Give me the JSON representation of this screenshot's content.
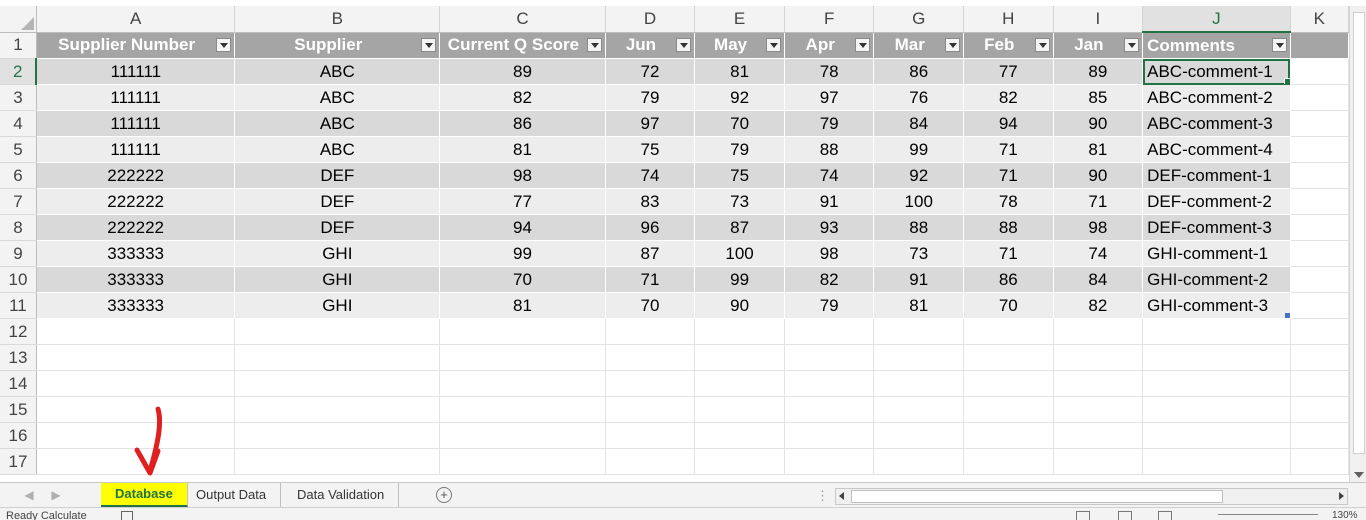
{
  "columns": [
    "A",
    "B",
    "C",
    "D",
    "E",
    "F",
    "G",
    "H",
    "I",
    "J",
    "K"
  ],
  "row_numbers": [
    "1",
    "2",
    "3",
    "4",
    "5",
    "6",
    "7",
    "8",
    "9",
    "10",
    "11",
    "12",
    "13",
    "14",
    "15",
    "16",
    "17"
  ],
  "table_headers": [
    "Supplier Number",
    "Supplier",
    "Current Q Score",
    "Jun",
    "May",
    "Apr",
    "Mar",
    "Feb",
    "Jan",
    "Comments"
  ],
  "rows": [
    [
      "111111",
      "ABC",
      "89",
      "72",
      "81",
      "78",
      "86",
      "77",
      "89",
      "ABC-comment-1"
    ],
    [
      "111111",
      "ABC",
      "82",
      "79",
      "92",
      "97",
      "76",
      "82",
      "85",
      "ABC-comment-2"
    ],
    [
      "111111",
      "ABC",
      "86",
      "97",
      "70",
      "79",
      "84",
      "94",
      "90",
      "ABC-comment-3"
    ],
    [
      "111111",
      "ABC",
      "81",
      "75",
      "79",
      "88",
      "99",
      "71",
      "81",
      "ABC-comment-4"
    ],
    [
      "222222",
      "DEF",
      "98",
      "74",
      "75",
      "74",
      "92",
      "71",
      "90",
      "DEF-comment-1"
    ],
    [
      "222222",
      "DEF",
      "77",
      "83",
      "73",
      "91",
      "100",
      "78",
      "71",
      "DEF-comment-2"
    ],
    [
      "222222",
      "DEF",
      "94",
      "96",
      "87",
      "93",
      "88",
      "88",
      "98",
      "DEF-comment-3"
    ],
    [
      "333333",
      "GHI",
      "99",
      "87",
      "100",
      "98",
      "73",
      "71",
      "74",
      "GHI-comment-1"
    ],
    [
      "333333",
      "GHI",
      "70",
      "71",
      "99",
      "82",
      "91",
      "86",
      "84",
      "GHI-comment-2"
    ],
    [
      "333333",
      "GHI",
      "81",
      "70",
      "90",
      "79",
      "81",
      "70",
      "82",
      "GHI-comment-3"
    ]
  ],
  "active_cell": "J2",
  "sheet_tabs": [
    "Database",
    "Output Data",
    "Data Validation"
  ],
  "active_tab": "Database",
  "add_sheet_label": "+",
  "status": {
    "ready_text": "Ready   Calculate",
    "zoom_text": "130%"
  },
  "colors": {
    "accent": "#217346",
    "table_header": "#a5a5a5",
    "band_dark": "#d9d9d9",
    "band_light": "#ededed",
    "tab_highlight": "#ffff00",
    "annotation": "#e02020"
  },
  "icons": [
    "filter-dropdown-icon",
    "add-sheet-icon",
    "scroll-left-icon",
    "scroll-right-icon",
    "scroll-down-icon",
    "macro-record-icon",
    "annotation-arrow-icon"
  ]
}
